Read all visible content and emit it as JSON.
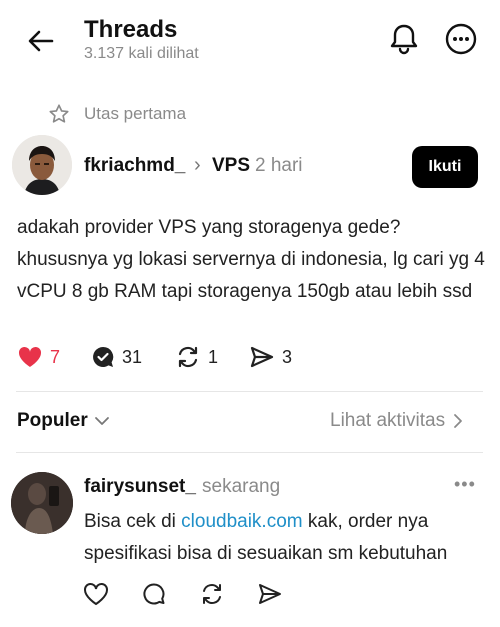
{
  "header": {
    "title": "Threads",
    "views": "3.137 kali dilihat"
  },
  "thread_label": "Utas pertama",
  "post": {
    "author": "fkriachmd_",
    "community": "VPS",
    "time": "2 hari",
    "follow_label": "Ikuti",
    "text": "adakah provider VPS yang storagenya gede? khususnya yg lokasi servernya di indonesia, lg cari yg 4 vCPU 8 gb RAM tapi storagenya  150gb atau lebih ssd",
    "likes": "7",
    "replies": "31",
    "reposts": "1",
    "shares": "3",
    "like_color": "#e8334a"
  },
  "sort": {
    "label": "Populer",
    "activity_label": "Lihat aktivitas"
  },
  "reply": {
    "author": "fairysunset_",
    "time": "sekarang",
    "text_before": "Bisa cek di ",
    "link": "cloudbaik.com",
    "text_after": " kak, order nya spesifikasi bisa di sesuaikan sm kebutuhan"
  },
  "icons": [
    "back-arrow-icon",
    "bell-icon",
    "more-icon",
    "star-icon",
    "heart-icon",
    "reply-icon",
    "repost-icon",
    "share-icon",
    "chevron-down-icon",
    "chevron-right-icon"
  ]
}
